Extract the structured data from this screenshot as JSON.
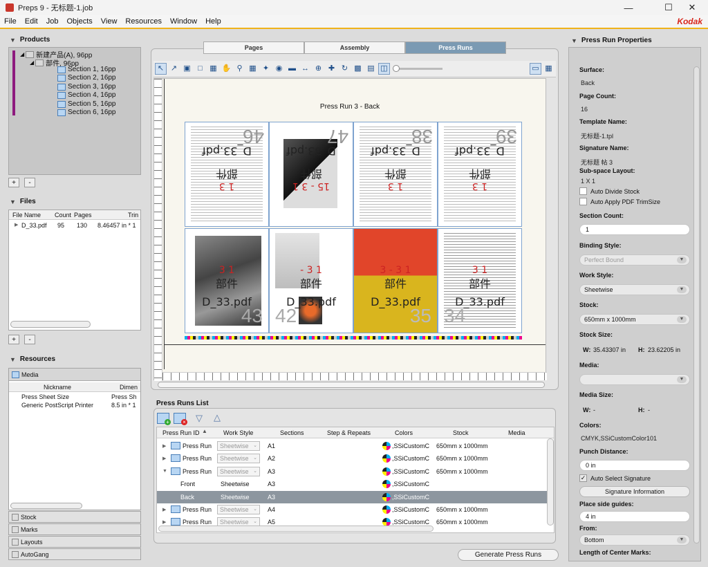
{
  "window": {
    "title": "Preps 9 - 无标题-1.job"
  },
  "menu": [
    "File",
    "Edit",
    "Job",
    "Objects",
    "View",
    "Resources",
    "Window",
    "Help"
  ],
  "brand": "Kodak",
  "products": {
    "title": "Products",
    "tree": [
      "新建产品(A), 96pp",
      "部件, 96pp",
      "Section 1, 16pp",
      "Section 2, 16pp",
      "Section 3, 16pp",
      "Section 4, 16pp",
      "Section 5, 16pp",
      "Section 6, 16pp"
    ],
    "add": "+",
    "remove": "-"
  },
  "files": {
    "title": "Files",
    "headers": [
      "File Name",
      "Count",
      "Pages",
      "Trin"
    ],
    "rows": [
      [
        "D_33.pdf",
        "95",
        "130",
        "8.46457 in * 1"
      ]
    ],
    "add": "+",
    "remove": "-"
  },
  "resources": {
    "title": "Resources",
    "media_tab": "Media",
    "headers": [
      "Nickname",
      "Dimen"
    ],
    "rows": [
      [
        "Press Sheet Size",
        "Press Sh"
      ],
      [
        "Generic PostScript Printer",
        "8.5 in * 1"
      ]
    ],
    "tabs": [
      "Stock",
      "Marks",
      "Layouts",
      "AutoGang"
    ]
  },
  "main_tabs": [
    "Pages",
    "Assembly",
    "Press Runs"
  ],
  "sheet": {
    "title": "Press Run 3 - Back",
    "top_cells": [
      {
        "label": "D_33.pdf",
        "sub": "部件",
        "nums": "1  3",
        "big": "46"
      },
      {
        "label": "D_33.pdf",
        "sub": "部件",
        "nums": "15 - 3  1",
        "big": "47"
      },
      {
        "label": "D_33.pdf",
        "sub": "部件",
        "nums": "1  3",
        "big": "38"
      },
      {
        "label": "D_33.pdf",
        "sub": "部件",
        "nums": "1  3",
        "big": "39"
      }
    ],
    "bottom_cells": [
      {
        "label": "D_33.pdf",
        "sub": "部件",
        "nums": "3  1",
        "big": "43"
      },
      {
        "label": "D_33.pdf",
        "sub": "部件",
        "nums": "- 3  1",
        "big": "42"
      },
      {
        "label": "D_33.pdf",
        "sub": "部件",
        "nums": "3 - 3  1",
        "big": "35"
      },
      {
        "label": "D_33.pdf",
        "sub": "部件",
        "nums": "3  1",
        "big": "34"
      }
    ]
  },
  "press_runs_list": {
    "title": "Press Runs List",
    "headers": [
      "Press Run ID",
      "Work Style",
      "Sections",
      "Step & Repeats",
      "Colors",
      "Stock",
      "Media"
    ],
    "rows": [
      {
        "id": "Press Run",
        "work": "Sheetwise",
        "sec": "A1",
        "colors": ",SSiCustomC",
        "stock": "650mm x 1000mm",
        "type": "run"
      },
      {
        "id": "Press Run",
        "work": "Sheetwise",
        "sec": "A2",
        "colors": ",SSiCustomC",
        "stock": "650mm x 1000mm",
        "type": "run"
      },
      {
        "id": "Press Run",
        "work": "Sheetwise",
        "sec": "A3",
        "colors": ",SSiCustomC",
        "stock": "650mm x 1000mm",
        "type": "run-open"
      },
      {
        "id": "Front",
        "work": "Sheetwise",
        "sec": "A3",
        "colors": ",SSiCustomC",
        "stock": "",
        "type": "side"
      },
      {
        "id": "Back",
        "work": "Sheetwise",
        "sec": "A3",
        "colors": ",SSiCustomC",
        "stock": "",
        "type": "side-sel"
      },
      {
        "id": "Press Run",
        "work": "Sheetwise",
        "sec": "A4",
        "colors": ",SSiCustomC",
        "stock": "650mm x 1000mm",
        "type": "run"
      },
      {
        "id": "Press Run",
        "work": "Sheetwise",
        "sec": "A5",
        "colors": ",SSiCustomC",
        "stock": "650mm x 1000mm",
        "type": "run"
      }
    ],
    "generate_button": "Generate Press Runs"
  },
  "properties": {
    "title": "Press Run Properties",
    "surface_label": "Surface:",
    "surface": "Back",
    "page_count_label": "Page Count:",
    "page_count": "16",
    "template_label": "Template Name:",
    "template": "无标题-1.tpl",
    "signature_label": "Signature Name:",
    "signature": "无标题 帖 3",
    "subspace_label": "Sub-space Layout:",
    "subspace": "1 X 1",
    "auto_divide": "Auto Divide Stock",
    "auto_trim": "Auto Apply PDF TrimSize",
    "section_count_label": "Section Count:",
    "section_count": "1",
    "binding_label": "Binding Style:",
    "binding": "Perfect Bound",
    "work_style_label": "Work Style:",
    "work_style": "Sheetwise",
    "stock_label": "Stock:",
    "stock": "650mm x 1000mm",
    "stock_size_label": "Stock Size:",
    "w_label": "W:",
    "w": "35.43307 in",
    "h_label": "H:",
    "h": "23.62205 in",
    "media_label": "Media:",
    "media": "",
    "media_size_label": "Media Size:",
    "mw_label": "W:",
    "mw": "-",
    "mh_label": "H:",
    "mh": "-",
    "colors_label": "Colors:",
    "colors": "CMYK,SSiCustomColor101",
    "punch_label": "Punch Distance:",
    "punch": "0 in",
    "auto_select": "Auto Select Signature",
    "sig_info_button": "Signature Information",
    "side_guides_label": "Place side guides:",
    "side_guides": "4 in",
    "from_label": "From:",
    "from": "Bottom",
    "center_marks_label": "Length of Center Marks:"
  }
}
